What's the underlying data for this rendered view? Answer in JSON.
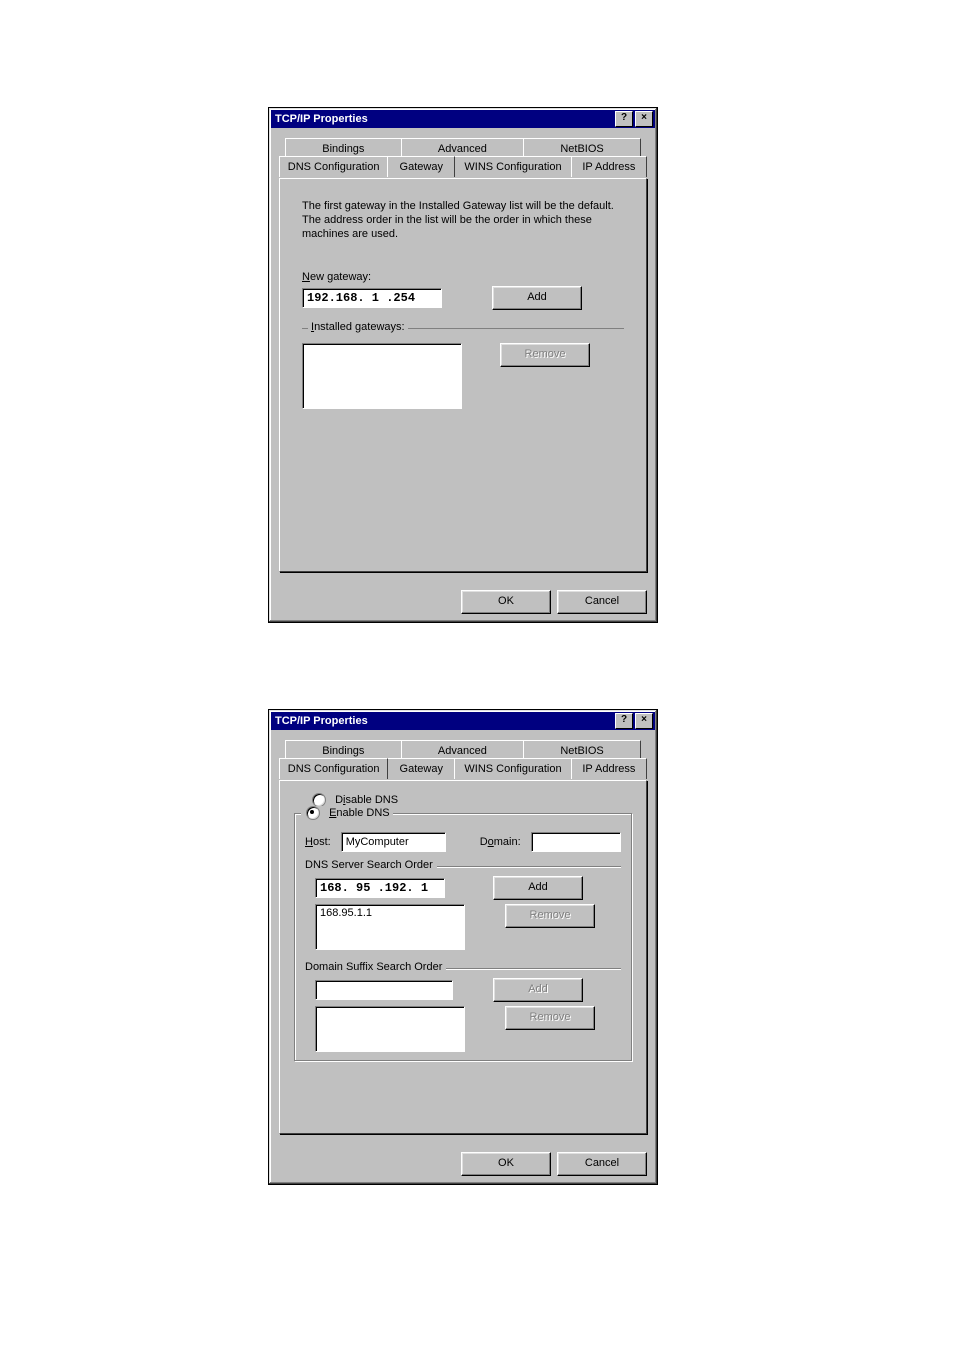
{
  "dialog1": {
    "title": "TCP/IP Properties",
    "tabs_back": [
      "Bindings",
      "Advanced",
      "NetBIOS"
    ],
    "tabs_front": [
      "DNS Configuration",
      "Gateway",
      "WINS Configuration",
      "IP Address"
    ],
    "active_tab": "Gateway",
    "description": "The first gateway in the Installed Gateway list will be the default. The address order in the list will be the order in which these machines are used.",
    "new_gateway_label": "New gateway:",
    "new_gateway_value": "192.168. 1 .254",
    "add_label": "Add",
    "installed_label": "Installed gateways:",
    "installed_list": [],
    "remove_label": "Remove",
    "ok_label": "OK",
    "cancel_label": "Cancel"
  },
  "dialog2": {
    "title": "TCP/IP Properties",
    "tabs_back": [
      "Bindings",
      "Advanced",
      "NetBIOS"
    ],
    "tabs_front": [
      "DNS Configuration",
      "Gateway",
      "WINS Configuration",
      "IP Address"
    ],
    "active_tab": "DNS Configuration",
    "disable_dns_label": "Disable DNS",
    "enable_dns_label": "Enable DNS",
    "dns_enabled": true,
    "host_label": "Host:",
    "host_value": "MyComputer",
    "domain_label": "Domain:",
    "domain_value": "",
    "dns_order_label": "DNS Server Search Order",
    "dns_new_value": "168. 95 .192. 1",
    "dns_list": [
      "168.95.1.1"
    ],
    "add_label": "Add",
    "remove_label": "Remove",
    "suffix_order_label": "Domain Suffix Search Order",
    "suffix_new_value": "",
    "suffix_list": [],
    "ok_label": "OK",
    "cancel_label": "Cancel"
  }
}
